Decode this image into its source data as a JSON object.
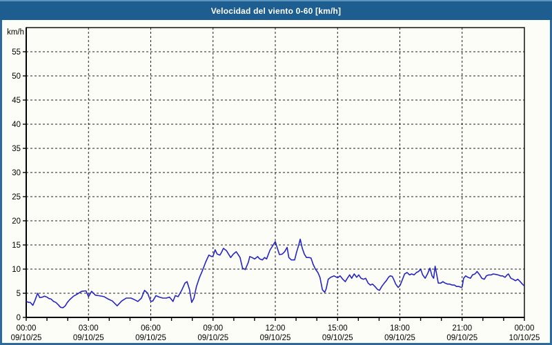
{
  "window": {
    "title": "Velocidad del viento 0-60 [km/h]"
  },
  "colors": {
    "titlebar_bg": "#1d5d90",
    "titlebar_top_strip": "#5b94bd",
    "titlebar_text": "#ffffff",
    "frame_border": "#2b6a9f",
    "page_bg": "#fdfdf8",
    "axis": "#000000",
    "grid": "#1a1a1a",
    "line": "#2424c4",
    "label_text": "#000000"
  },
  "chart_data": {
    "type": "line",
    "title": "Velocidad del viento 0-60 [km/h]",
    "unit_label": "km/h",
    "xlim_hours": [
      0,
      24
    ],
    "ylim": [
      0,
      60
    ],
    "y_tick_step": 5,
    "y_tick_labels": [
      "0",
      "5",
      "10",
      "15",
      "20",
      "25",
      "30",
      "35",
      "40",
      "45",
      "50",
      "55"
    ],
    "grid": "dashed",
    "legend": "none",
    "x_minor_tick_every_hours": 1,
    "x_major_ticks": [
      {
        "hours": 0,
        "time": "00:00",
        "date": "09/10/25"
      },
      {
        "hours": 3,
        "time": "03:00",
        "date": "09/10/25"
      },
      {
        "hours": 6,
        "time": "06:00",
        "date": "09/10/25"
      },
      {
        "hours": 9,
        "time": "09:00",
        "date": "09/10/25"
      },
      {
        "hours": 12,
        "time": "12:00",
        "date": "09/10/25"
      },
      {
        "hours": 15,
        "time": "15:00",
        "date": "09/10/25"
      },
      {
        "hours": 18,
        "time": "18:00",
        "date": "09/10/25"
      },
      {
        "hours": 21,
        "time": "21:00",
        "date": "09/10/25"
      },
      {
        "hours": 24,
        "time": "00:00",
        "date": "10/10/25"
      }
    ],
    "series": [
      {
        "name": "velocidad del viento",
        "color": "#2424c4",
        "points": [
          [
            0.0,
            3.3
          ],
          [
            0.12,
            3.1
          ],
          [
            0.2,
            3.1
          ],
          [
            0.32,
            2.5
          ],
          [
            0.43,
            3.6
          ],
          [
            0.55,
            5.0
          ],
          [
            0.65,
            4.1
          ],
          [
            0.78,
            4.2
          ],
          [
            0.88,
            4.4
          ],
          [
            1.0,
            4.2
          ],
          [
            1.1,
            3.9
          ],
          [
            1.2,
            3.8
          ],
          [
            1.32,
            3.3
          ],
          [
            1.43,
            3.1
          ],
          [
            1.55,
            2.6
          ],
          [
            1.65,
            2.1
          ],
          [
            1.77,
            2.0
          ],
          [
            1.88,
            2.4
          ],
          [
            1.98,
            3.1
          ],
          [
            2.1,
            3.7
          ],
          [
            2.28,
            4.4
          ],
          [
            2.45,
            4.8
          ],
          [
            2.67,
            5.4
          ],
          [
            2.88,
            5.5
          ],
          [
            3.0,
            4.3
          ],
          [
            3.15,
            5.4
          ],
          [
            3.33,
            4.6
          ],
          [
            3.5,
            4.5
          ],
          [
            3.75,
            4.3
          ],
          [
            3.95,
            3.8
          ],
          [
            4.15,
            3.4
          ],
          [
            4.38,
            2.4
          ],
          [
            4.6,
            3.4
          ],
          [
            4.82,
            4.0
          ],
          [
            5.05,
            4.0
          ],
          [
            5.25,
            3.6
          ],
          [
            5.38,
            3.3
          ],
          [
            5.55,
            4.0
          ],
          [
            5.7,
            5.6
          ],
          [
            5.85,
            5.0
          ],
          [
            6.0,
            3.3
          ],
          [
            6.1,
            3.4
          ],
          [
            6.25,
            4.5
          ],
          [
            6.42,
            4.2
          ],
          [
            6.58,
            4.0
          ],
          [
            6.75,
            4.0
          ],
          [
            6.9,
            4.2
          ],
          [
            6.98,
            3.8
          ],
          [
            7.07,
            3.3
          ],
          [
            7.18,
            4.5
          ],
          [
            7.32,
            4.3
          ],
          [
            7.5,
            5.7
          ],
          [
            7.65,
            7.1
          ],
          [
            7.75,
            7.4
          ],
          [
            7.87,
            5.7
          ],
          [
            7.97,
            3.1
          ],
          [
            8.08,
            4.0
          ],
          [
            8.2,
            6.4
          ],
          [
            8.35,
            8.3
          ],
          [
            8.5,
            9.8
          ],
          [
            8.65,
            11.5
          ],
          [
            8.8,
            12.9
          ],
          [
            8.93,
            12.6
          ],
          [
            9.0,
            12.7
          ],
          [
            9.1,
            14.0
          ],
          [
            9.2,
            13.1
          ],
          [
            9.33,
            12.9
          ],
          [
            9.4,
            13.4
          ],
          [
            9.5,
            14.3
          ],
          [
            9.65,
            13.8
          ],
          [
            9.75,
            13.1
          ],
          [
            9.85,
            12.4
          ],
          [
            9.98,
            13.1
          ],
          [
            10.12,
            13.6
          ],
          [
            10.3,
            12.4
          ],
          [
            10.42,
            10.2
          ],
          [
            10.55,
            9.9
          ],
          [
            10.7,
            11.4
          ],
          [
            10.77,
            12.6
          ],
          [
            10.88,
            12.4
          ],
          [
            11.0,
            12.1
          ],
          [
            11.1,
            12.4
          ],
          [
            11.15,
            12.6
          ],
          [
            11.25,
            12.1
          ],
          [
            11.38,
            11.9
          ],
          [
            11.48,
            12.4
          ],
          [
            11.58,
            12.1
          ],
          [
            11.65,
            12.9
          ],
          [
            11.75,
            14.0
          ],
          [
            11.87,
            14.8
          ],
          [
            12.0,
            15.7
          ],
          [
            12.1,
            14.3
          ],
          [
            12.2,
            13.0
          ],
          [
            12.33,
            13.1
          ],
          [
            12.45,
            13.6
          ],
          [
            12.57,
            14.5
          ],
          [
            12.65,
            12.4
          ],
          [
            12.77,
            11.9
          ],
          [
            12.93,
            11.9
          ],
          [
            13.03,
            13.6
          ],
          [
            13.13,
            15.0
          ],
          [
            13.2,
            16.2
          ],
          [
            13.3,
            14.3
          ],
          [
            13.4,
            13.1
          ],
          [
            13.5,
            12.4
          ],
          [
            13.62,
            12.4
          ],
          [
            13.72,
            12.3
          ],
          [
            13.82,
            11.0
          ],
          [
            13.93,
            10.0
          ],
          [
            14.05,
            9.3
          ],
          [
            14.15,
            8.3
          ],
          [
            14.27,
            5.7
          ],
          [
            14.38,
            5.2
          ],
          [
            14.45,
            5.9
          ],
          [
            14.55,
            7.9
          ],
          [
            14.67,
            8.3
          ],
          [
            14.83,
            8.6
          ],
          [
            15.0,
            8.2
          ],
          [
            15.12,
            8.6
          ],
          [
            15.25,
            7.9
          ],
          [
            15.37,
            7.4
          ],
          [
            15.47,
            8.1
          ],
          [
            15.58,
            8.8
          ],
          [
            15.68,
            8.1
          ],
          [
            15.8,
            9.0
          ],
          [
            15.92,
            8.3
          ],
          [
            16.02,
            8.8
          ],
          [
            16.13,
            8.1
          ],
          [
            16.25,
            7.9
          ],
          [
            16.35,
            8.1
          ],
          [
            16.47,
            7.1
          ],
          [
            16.58,
            6.7
          ],
          [
            16.68,
            6.9
          ],
          [
            16.8,
            6.4
          ],
          [
            16.92,
            5.8
          ],
          [
            17.02,
            5.6
          ],
          [
            17.13,
            6.4
          ],
          [
            17.25,
            7.1
          ],
          [
            17.35,
            7.6
          ],
          [
            17.45,
            8.3
          ],
          [
            17.53,
            8.6
          ],
          [
            17.63,
            8.5
          ],
          [
            17.7,
            7.9
          ],
          [
            17.8,
            6.9
          ],
          [
            17.92,
            6.2
          ],
          [
            18.02,
            6.7
          ],
          [
            18.13,
            7.9
          ],
          [
            18.23,
            9.0
          ],
          [
            18.35,
            9.3
          ],
          [
            18.47,
            8.8
          ],
          [
            18.57,
            9.0
          ],
          [
            18.68,
            8.8
          ],
          [
            18.8,
            9.3
          ],
          [
            18.9,
            9.5
          ],
          [
            19.0,
            10.0
          ],
          [
            19.1,
            8.8
          ],
          [
            19.22,
            8.1
          ],
          [
            19.33,
            9.0
          ],
          [
            19.45,
            10.2
          ],
          [
            19.55,
            8.6
          ],
          [
            19.63,
            8.1
          ],
          [
            19.7,
            10.6
          ],
          [
            19.78,
            8.8
          ],
          [
            19.85,
            7.1
          ],
          [
            19.97,
            7.1
          ],
          [
            20.07,
            7.4
          ],
          [
            20.18,
            7.1
          ],
          [
            20.3,
            6.9
          ],
          [
            20.4,
            6.9
          ],
          [
            20.52,
            6.7
          ],
          [
            20.63,
            6.7
          ],
          [
            20.73,
            6.4
          ],
          [
            20.85,
            6.4
          ],
          [
            20.97,
            6.2
          ],
          [
            21.0,
            6.3
          ],
          [
            21.07,
            8.1
          ],
          [
            21.17,
            8.6
          ],
          [
            21.28,
            8.3
          ],
          [
            21.4,
            8.1
          ],
          [
            21.5,
            8.8
          ],
          [
            21.62,
            9.0
          ],
          [
            21.72,
            9.5
          ],
          [
            21.85,
            8.8
          ],
          [
            21.95,
            8.1
          ],
          [
            22.07,
            7.9
          ],
          [
            22.17,
            8.6
          ],
          [
            22.28,
            8.8
          ],
          [
            22.4,
            8.8
          ],
          [
            22.5,
            9.0
          ],
          [
            22.62,
            8.9
          ],
          [
            22.73,
            8.8
          ],
          [
            22.85,
            8.6
          ],
          [
            22.95,
            8.6
          ],
          [
            23.07,
            8.3
          ],
          [
            23.17,
            8.8
          ],
          [
            23.23,
            9.0
          ],
          [
            23.35,
            8.1
          ],
          [
            23.45,
            7.9
          ],
          [
            23.57,
            7.6
          ],
          [
            23.68,
            7.9
          ],
          [
            23.8,
            7.4
          ],
          [
            23.9,
            6.9
          ],
          [
            24.0,
            6.5
          ]
        ]
      }
    ]
  }
}
